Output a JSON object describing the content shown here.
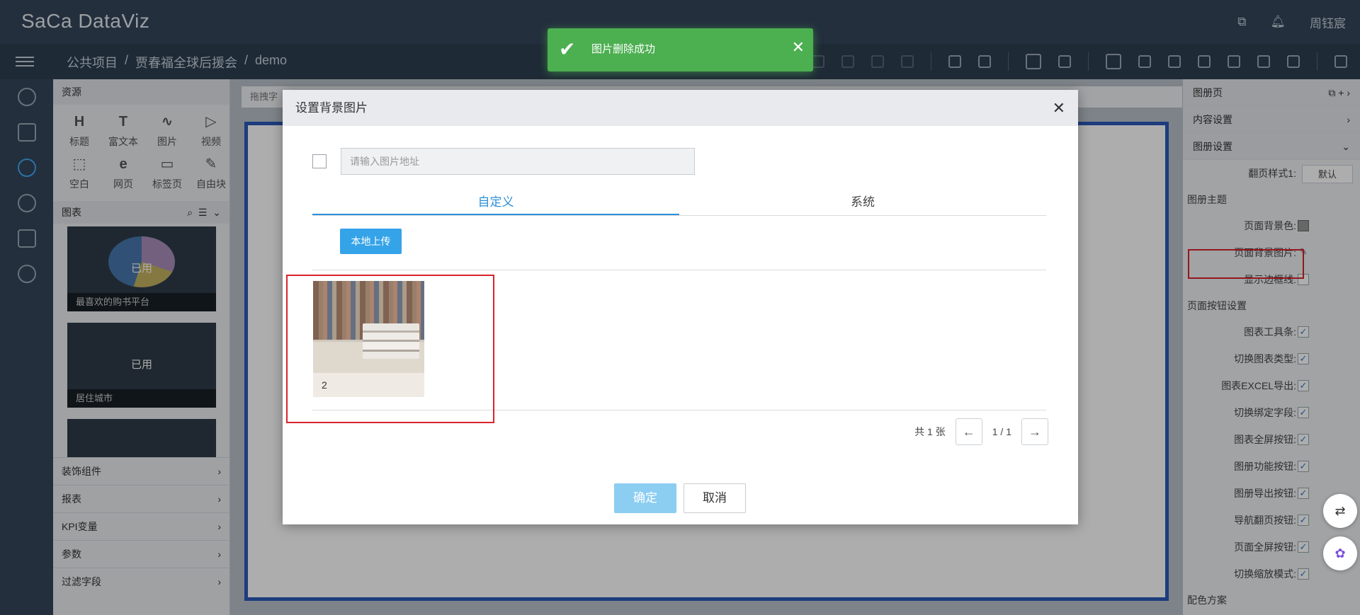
{
  "app": {
    "logo": "SaCa DataViz",
    "user": "周钰宸"
  },
  "breadcrumb": [
    "公共项目",
    "/",
    "贾春福全球后援会",
    "/",
    "demo"
  ],
  "left_nav": [
    "user-icon",
    "monitor-icon",
    "refresh-icon",
    "play-icon",
    "chart-icon",
    "gear-icon"
  ],
  "resources": {
    "title": "资源",
    "items": [
      {
        "icon": "H",
        "label": "标题"
      },
      {
        "icon": "T",
        "label": "富文本"
      },
      {
        "icon": "∿",
        "label": "图片"
      },
      {
        "icon": "▷",
        "label": "视频"
      },
      {
        "icon": "⬚",
        "label": "空白"
      },
      {
        "icon": "e",
        "label": "网页"
      },
      {
        "icon": "▭",
        "label": "标签页"
      },
      {
        "icon": "✎",
        "label": "自由块"
      }
    ],
    "charts_title": "图表",
    "cards": [
      {
        "status": "已用",
        "caption": "最喜欢的购书平台"
      },
      {
        "status": "已用",
        "caption": "居住城市"
      },
      {
        "status": "",
        "caption": ""
      }
    ],
    "accordion": [
      "装饰组件",
      "报表",
      "KPI变量",
      "参数",
      "过滤字段"
    ]
  },
  "canvas": {
    "drag_hint": "拖拽字"
  },
  "right_panel": {
    "album_page": "图册页",
    "content_settings": "内容设置",
    "album_settings": "图册设置",
    "page_style_label": "翻页样式1:",
    "page_style_value": "默认",
    "theme_title": "图册主题",
    "bg_color_label": "页面背景色:",
    "bg_image_label": "页面背景图片:",
    "border_label": "显示边框线:",
    "button_settings": "页面按钮设置",
    "options": [
      {
        "label": "图表工具条:",
        "checked": true
      },
      {
        "label": "切换图表类型:",
        "checked": true
      },
      {
        "label": "图表EXCEL导出:",
        "checked": true
      },
      {
        "label": "切换绑定字段:",
        "checked": true
      },
      {
        "label": "图表全屏按钮:",
        "checked": true
      },
      {
        "label": "图册功能按钮:",
        "checked": true
      },
      {
        "label": "图册导出按钮:",
        "checked": true
      },
      {
        "label": "导航翻页按钮:",
        "checked": true
      },
      {
        "label": "页面全屏按钮:",
        "checked": true
      },
      {
        "label": "切换缩放模式:",
        "checked": true
      }
    ],
    "color_scheme": "配色方案"
  },
  "modal": {
    "title": "设置背景图片",
    "url_placeholder": "请输入图片地址",
    "tabs": [
      "自定义",
      "系统"
    ],
    "upload_button": "本地上传",
    "images": [
      {
        "name": "2"
      }
    ],
    "total": "共 1 张",
    "page": "1 / 1",
    "ok": "确定",
    "cancel": "取消"
  },
  "toast": {
    "message": "图片删除成功"
  },
  "colors": {
    "accent": "#2e90d8",
    "toast": "#4caf50",
    "highlight": "#d9232d"
  }
}
